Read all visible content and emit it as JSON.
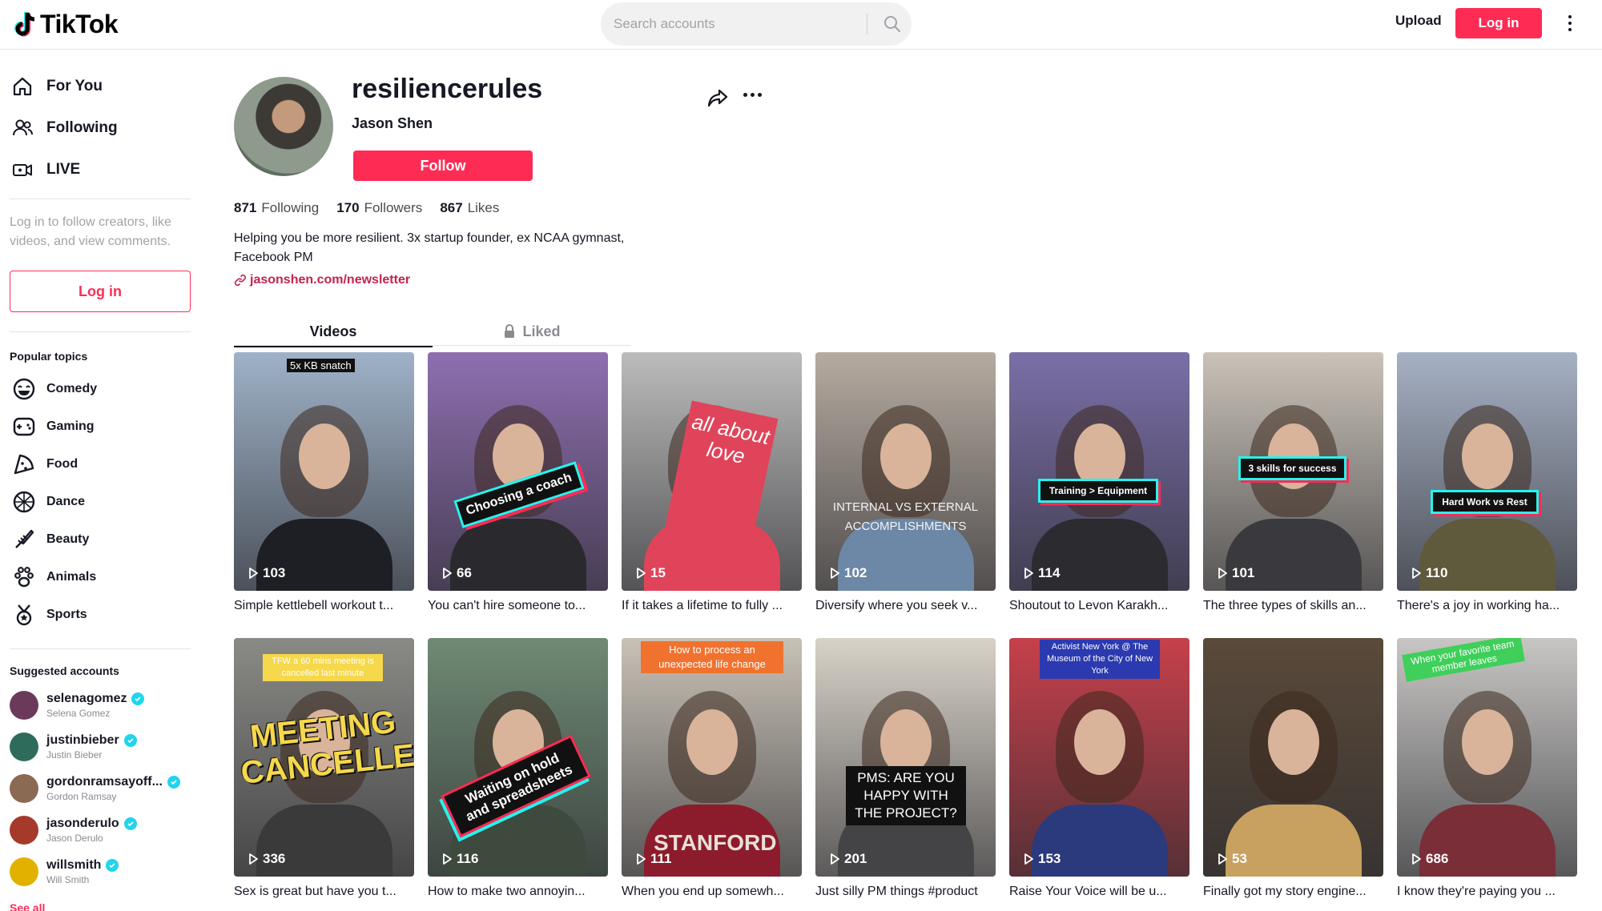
{
  "header": {
    "logo_text": "TikTok",
    "search_placeholder": "Search accounts",
    "upload_label": "Upload",
    "login_label": "Log in"
  },
  "sidebar": {
    "nav": [
      {
        "label": "For You",
        "icon": "home-icon"
      },
      {
        "label": "Following",
        "icon": "people-icon"
      },
      {
        "label": "LIVE",
        "icon": "live-icon"
      }
    ],
    "login_prompt": "Log in to follow creators, like videos, and view comments.",
    "login_label": "Log in",
    "popular_title": "Popular topics",
    "topics": [
      {
        "label": "Comedy",
        "icon": "smile-icon"
      },
      {
        "label": "Gaming",
        "icon": "gamepad-icon"
      },
      {
        "label": "Food",
        "icon": "food-icon"
      },
      {
        "label": "Dance",
        "icon": "dance-icon"
      },
      {
        "label": "Beauty",
        "icon": "beauty-icon"
      },
      {
        "label": "Animals",
        "icon": "paw-icon"
      },
      {
        "label": "Sports",
        "icon": "trophy-icon"
      }
    ],
    "suggested_title": "Suggested accounts",
    "accounts": [
      {
        "username": "selenagomez",
        "name": "Selena Gomez",
        "color": "#6b3a5b"
      },
      {
        "username": "justinbieber",
        "name": "Justin Bieber",
        "color": "#2f6b5a"
      },
      {
        "username": "gordonramsayoff...",
        "name": "Gordon Ramsay",
        "color": "#8a6a52"
      },
      {
        "username": "jasonderulo",
        "name": "Jason Derulo",
        "color": "#a53a2a"
      },
      {
        "username": "willsmith",
        "name": "Will Smith",
        "color": "#e2b100"
      }
    ],
    "see_all": "See all"
  },
  "profile": {
    "username": "resiliencerules",
    "display_name": "Jason Shen",
    "follow_label": "Follow",
    "following_count": "871",
    "following_label": "Following",
    "followers_count": "170",
    "followers_label": "Followers",
    "likes_count": "867",
    "likes_label": "Likes",
    "bio": "Helping you be more resilient. 3x startup founder, ex NCAA gymnast, Facebook PM",
    "link": "jasonshen.com/newsletter"
  },
  "tabs": {
    "videos": "Videos",
    "liked": "Liked"
  },
  "videos": [
    {
      "plays": "103",
      "caption": "Simple kettlebell workout t...",
      "overlay": "5x KB snatch",
      "bg": "#9fb2c8",
      "shirt": "#1d1f24"
    },
    {
      "plays": "66",
      "caption": "You can't hire someone to...",
      "overlay": "Choosing a coach",
      "bg": "#8e6fb0",
      "shirt": "#2a2a2e"
    },
    {
      "plays": "15",
      "caption": "If it takes a lifetime to fully ...",
      "overlay": "all about love",
      "bg": "#bcbcbc",
      "shirt": "#e0445a"
    },
    {
      "plays": "102",
      "caption": "Diversify where you seek v...",
      "overlay": "INTERNAL VS EXTERNAL ACCOMPLISHMENTS",
      "bg": "#b5aba0",
      "shirt": "#6d88a6"
    },
    {
      "plays": "114",
      "caption": "Shoutout to Levon Karakh...",
      "overlay": "Training > Equipment",
      "bg": "#7b6fa8",
      "shirt": "#2b2b30"
    },
    {
      "plays": "101",
      "caption": "The three types of skills an...",
      "overlay": "3 skills for success",
      "bg": "#c9c2b8",
      "shirt": "#3a3a3e"
    },
    {
      "plays": "110",
      "caption": "There's a joy in working ha...",
      "overlay": "Hard Work vs Rest",
      "bg": "#a6b1c4",
      "shirt": "#5f5a3c"
    },
    {
      "plays": "336",
      "caption": "Sex is great but have you t...",
      "overlay": "MEETING CANCELLED",
      "top_note": "TFW a 60 mins meeting is cancelled last minute",
      "bg": "#8a8a86",
      "shirt": "#3a3a3a"
    },
    {
      "plays": "116",
      "caption": "How to make two annoyin...",
      "overlay": "Waiting on hold and spreadsheets",
      "bg": "#6f8a74",
      "shirt": "#3d4a3d"
    },
    {
      "plays": "111",
      "caption": "When you end up somewh...",
      "overlay": "How to process an unexpected life change",
      "bottom_note": "STANFORD",
      "bg": "#c8c1b6",
      "shirt": "#8c1c2c"
    },
    {
      "plays": "201",
      "caption": "Just silly PM things #product",
      "overlay": "PMS: ARE YOU HAPPY WITH THE PROJECT?",
      "bg": "#d8d2c8",
      "shirt": "#444447"
    },
    {
      "plays": "153",
      "caption": "Raise Your Voice will be u...",
      "overlay": "Activist New York @ The Museum of the City of New York",
      "bg": "#c6404b",
      "shirt": "#2b3a7c"
    },
    {
      "plays": "53",
      "caption": "Finally got my story engine...",
      "overlay": "",
      "bg": "#5a4a3a",
      "shirt": "#c8a060"
    },
    {
      "plays": "686",
      "caption": "I know they're paying you ...",
      "overlay": "When your favorite team member leaves",
      "bg": "#c8c6c4",
      "shirt": "#7a2e38"
    }
  ],
  "colors": {
    "brand": "#fe2c55",
    "link": "#c3234d",
    "verified": "#20d5ec"
  }
}
